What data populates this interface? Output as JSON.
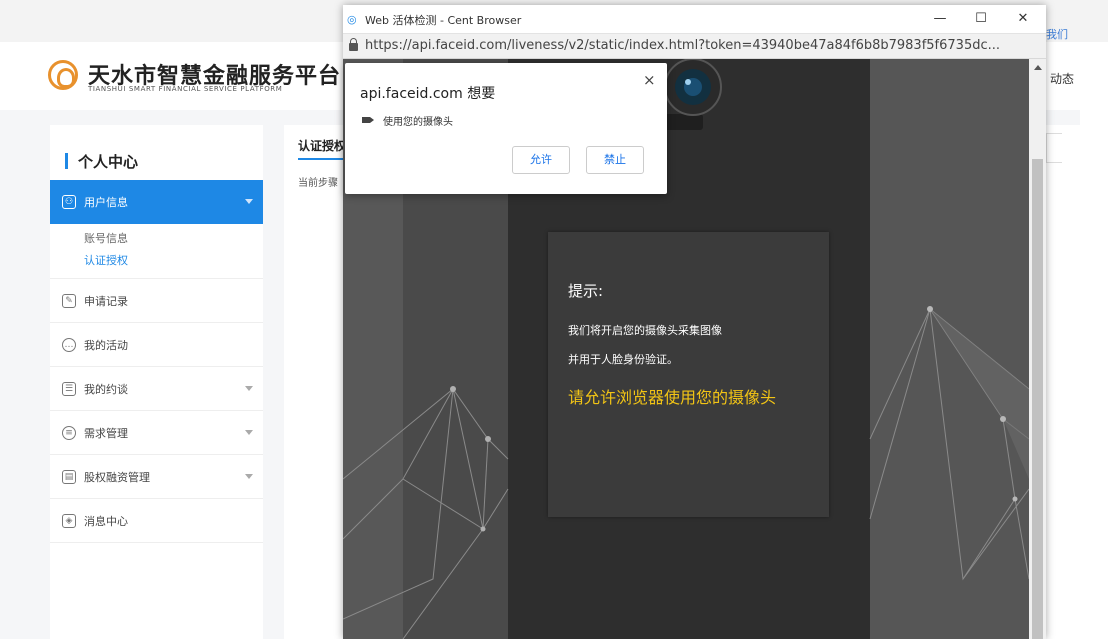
{
  "site": {
    "top_right_link": "我们",
    "header_right": "动态",
    "logo_title": "天水市智慧金融服务平台",
    "logo_subtitle": "TIANSHUI SMART FINANCIAL SERVICE PLATFORM",
    "sidebar": {
      "title": "个人中心",
      "items": [
        {
          "label": "用户信息",
          "icon": "user-icon",
          "active": true,
          "expandable": true
        },
        {
          "label": "申请记录",
          "icon": "edit-icon",
          "expandable": false
        },
        {
          "label": "我的活动",
          "icon": "chat-icon",
          "expandable": false
        },
        {
          "label": "我的约谈",
          "icon": "calendar-icon",
          "expandable": true
        },
        {
          "label": "需求管理",
          "icon": "message-icon",
          "expandable": true
        },
        {
          "label": "股权融资管理",
          "icon": "document-icon",
          "expandable": true
        },
        {
          "label": "消息中心",
          "icon": "box-icon",
          "expandable": false
        }
      ],
      "submenu": [
        {
          "label": "账号信息",
          "selected": false
        },
        {
          "label": "认证授权",
          "selected": true
        }
      ]
    },
    "main": {
      "tab": "认证授权",
      "step_label": "当前步骤"
    }
  },
  "popup_window": {
    "title": "Web 活体检测 - Cent Browser",
    "url": "https://api.faceid.com/liveness/v2/static/index.html?token=43940be47a84f6b8b7983f5f6735dc...",
    "buttons": {
      "minimize": "—",
      "maximize": "☐",
      "close": "✕"
    },
    "tip": {
      "title": "提示:",
      "line1": "我们将开启您的摄像头采集图像",
      "line2": "并用于人脸身份验证。",
      "highlight": "请允许浏览器使用您的摄像头"
    }
  },
  "permission_dialog": {
    "title": "api.faceid.com 想要",
    "request": "使用您的摄像头",
    "allow_label": "允许",
    "block_label": "禁止",
    "close": "×"
  },
  "colors": {
    "accent": "#1e88e5",
    "highlight_text": "#f2c415",
    "dark_bg": "#3d3d3d",
    "logo": "#e8912d"
  }
}
